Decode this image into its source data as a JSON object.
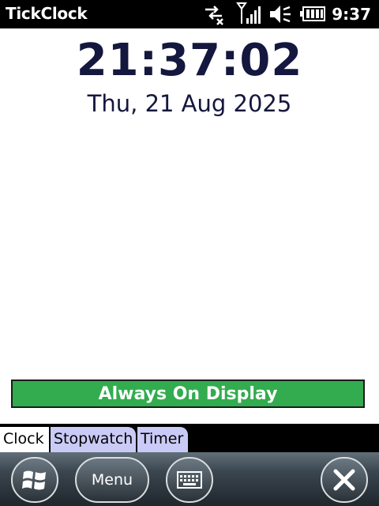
{
  "titlebar": {
    "app_title": "TickClock",
    "clock": "9:37",
    "icons": [
      "sync-arrows-icon",
      "signal-icon",
      "volume-icon",
      "battery-icon"
    ]
  },
  "main": {
    "time": "21:37:02",
    "date": "Thu, 21 Aug 2025"
  },
  "aod_button": {
    "label": "Always On Display",
    "color": "#32ac4e"
  },
  "tabs": [
    {
      "label": "Clock",
      "active": true
    },
    {
      "label": "Stopwatch",
      "active": false
    },
    {
      "label": "Timer",
      "active": false
    }
  ],
  "softkeys": {
    "menu_label": "Menu",
    "icons": [
      "windows-start-icon",
      "keyboard-icon",
      "close-icon"
    ]
  },
  "colors": {
    "text_dark": "#14173e",
    "inactive_tab": "#cacaf6"
  }
}
